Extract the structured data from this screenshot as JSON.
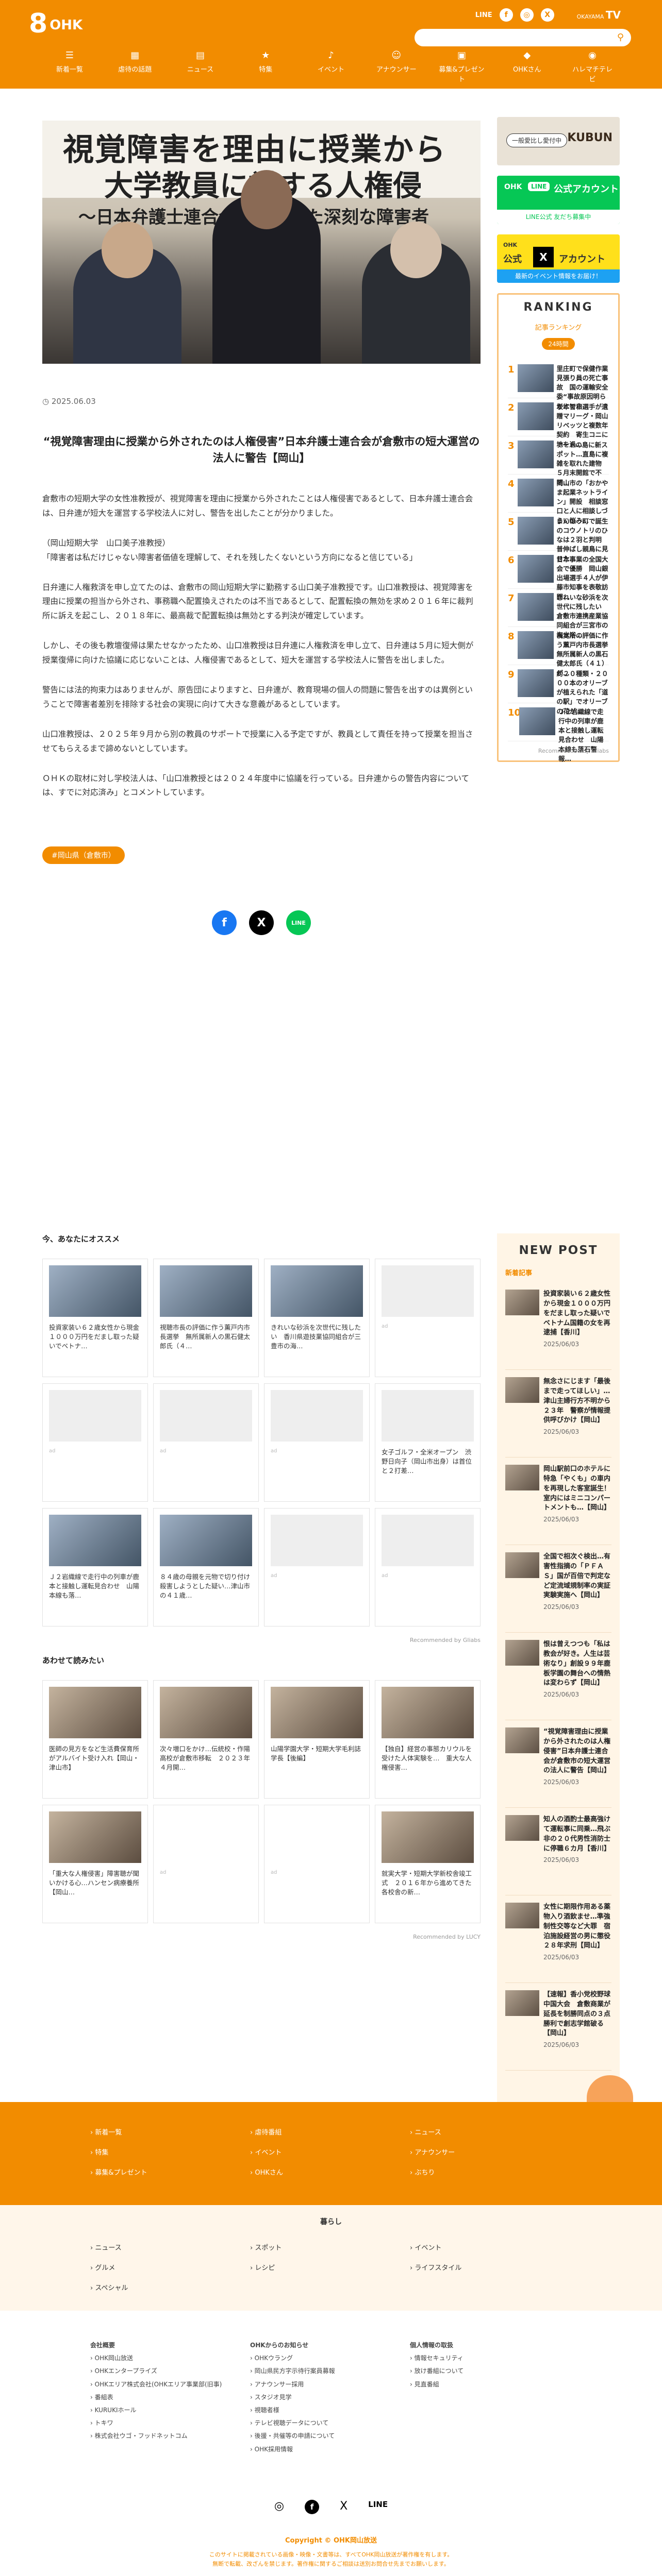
{
  "brand": {
    "logo_num": "8",
    "logo_text": "OHK",
    "tv_mark": "TV",
    "tv_brand": "OKAYAMA"
  },
  "search": {
    "placeholder": ""
  },
  "nav": [
    {
      "icon": "☰",
      "label": "新着一覧"
    },
    {
      "icon": "▦",
      "label": "虐待の話題"
    },
    {
      "icon": "▤",
      "label": "ニュース"
    },
    {
      "icon": "★",
      "label": "特集"
    },
    {
      "icon": "♪",
      "label": "イベント"
    },
    {
      "icon": "☺",
      "label": "アナウンサー"
    },
    {
      "icon": "▣",
      "label": "募集&プレゼント"
    },
    {
      "icon": "◆",
      "label": "OHKさん"
    },
    {
      "icon": "◉",
      "label": "ハレマチテレビ"
    }
  ],
  "article": {
    "hero_text": [
      "視覚障害を理由に授業から",
      "大学教員に対する人権侵",
      "～日本弁護士連合会が認定した深刻な障害者"
    ],
    "date": "2025.06.03",
    "title": "“視覚障害理由に授業から外されたのは人権侵害”日本弁護士連合会が倉敷市の短大運営の法人に警告【岡山】",
    "paragraphs": [
      "倉敷市の短期大学の女性准教授が、視覚障害を理由に授業から外されたことは人権侵害であるとして、日本弁護士連合会は、日弁連が短大を運営する学校法人に対し、警告を出したことが分かりました。",
      "（岡山短期大学　山口美子准教授）\n「障害者は私だけじゃない障害者価値を理解して、それを残したくないという方向になると信じている」",
      "日弁連に人権救済を申し立てたのは、倉敷市の岡山短期大学に勤務する山口美子准教授です。山口准教授は、視覚障害を理由に授業の担当から外され、事務職へ配置換えされたのは不当であるとして、配置転換の無効を求め２０１６年に裁判所に訴えを起こし、２０１８年に、最高裁で配置転換は無効とする判決が確定しています。",
      "しかし、その後も教壇復帰は果たせなかったため、山口准教授は日弁連に人権救済を申し立て、日弁連は５月に短大側が授業復帰に向けた協議に応じないことは、人権侵害であるとして、短大を運営する学校法人に警告を出しました。",
      "警告には法的拘束力はありませんが、原告団によりますと、日弁連が、教育現場の個人の問題に警告を出すのは異例ということで障害者差別を排除する社会の実現に向けて大きな意義があるとしています。",
      "山口准教授は、２０２５年９月から別の教員のサポートで授業に入る予定ですが、教員として責任を持って授業を担当させてもらえるまで諦めないとしています。",
      "ＯＨＫの取材に対し学校法人は、「山口准教授とは２０２４年度中に協議を行っている。日弁連からの警告内容については、すでに対応済み」とコメントしています。"
    ],
    "tag": "#岡山県（倉敷市）"
  },
  "share": {
    "facebook": "f",
    "x": "X",
    "line": "LINE"
  },
  "side": {
    "banner1": {
      "label": "一般愛比し愛付中",
      "brand": "KUBUN"
    },
    "banner2": {
      "brand": "OHK",
      "line": "LINE",
      "title": "公式アカウント",
      "sub": "LINE公式 友だち募集中"
    },
    "banner3": {
      "brand": "OHK",
      "x": "X",
      "title": "公式",
      "title2": "アカウント",
      "sub": "最新のイベント情報をお届け！"
    },
    "ranking_title": "RANKING",
    "ranking_tab": "記事ランキング",
    "ranking_pill": "24時間",
    "ranking": [
      {
        "n": "1",
        "t": "里庄町で保健作業見張り員の死亡事故　国の運輸安全委“事故原因明らかにでき…"
      },
      {
        "n": "2",
        "t": "坂本智和選手が遺贈マリーグ・岡山リベッツと複数年契約　寄生コニに地を過…"
      },
      {
        "n": "3",
        "t": "アートの島に新スポット…直島に複雑を取れた建物　５月末開館で不明…"
      },
      {
        "n": "4",
        "t": "岡山市の「おかやま起業ネットライン」開設　相談窓口と人に相談しづらい悩み…"
      },
      {
        "n": "5",
        "t": "まんのう町で誕生のコウノトリのひなは２羽と判明　普伸ばし親鳥に見せた…"
      },
      {
        "n": "6",
        "t": "日本事業の全国大会で優勝　岡山銀出場選手４人が伊藤市知事を表敬訪問…"
      },
      {
        "n": "7",
        "t": "きれいな砂浜を次世代に残したい　倉敷市連携産業協同組合が三宮市の海水浴…"
      },
      {
        "n": "8",
        "t": "視覚所の評価に作う薫戸内市長選挙　無所属新人の黒石健太郎氏（４１）が…"
      },
      {
        "n": "9",
        "t": "約２０種類・２０００本のオリーブが植えられた「道の駅」でオリーブの花が…"
      },
      {
        "n": "10",
        "t": "Ｊ２岩織線で走行中の列車が鹿本と接触し運転見合わせ　山陽本線も落石警報…"
      }
    ],
    "powered": "Recommended by Gliabs"
  },
  "recommend": {
    "title": "今、あなたにオススメ",
    "cards": [
      {
        "t": "投資家装い６２歳女性から現金１０００万円をだまし取った疑いでベトナ…",
        "img": true
      },
      {
        "t": "視聴市長の評価に作う薫戸内市長選挙　無所属新人の黒石健太郎氏（４…",
        "img": true
      },
      {
        "t": "きれいな砂浜を次世代に残したい　香川県遊技業協同組合が三豊市の海…",
        "img": true
      },
      {
        "t": "ad",
        "img": false
      },
      {
        "t": "ad",
        "img": false
      },
      {
        "t": "ad",
        "img": false
      },
      {
        "t": "ad",
        "img": false
      },
      {
        "t": "女子ゴルフ・全米オープン　渋野日向子（岡山市出身）は首位と２打差…",
        "img": false
      },
      {
        "t": "Ｊ２岩織線で走行中の列車が鹿本と接触し運転見合わせ　山陽本線も落…",
        "img": true
      },
      {
        "t": "８４歳の母親を元物で切り付け殺害しようとした疑い…津山市の４１歳…",
        "img": true
      },
      {
        "t": "ad",
        "img": false
      },
      {
        "t": "ad",
        "img": false
      }
    ],
    "powered": "Recommended by Gliabs"
  },
  "also": {
    "title": "あわせて読みたい",
    "cards": [
      {
        "t": "医師の見方をなど生活費保育所がアルバイト受け入れ【岡山・津山市】"
      },
      {
        "t": "次々増口をかけ…伝統校・作陽高校が倉敷市移転　２０２３年４月開…"
      },
      {
        "t": "山陽学園大学・短期大学毛利誌学長【後編】"
      },
      {
        "t": "【独自】経営の事態カリウルを受けた人体実験を…　重大な人権侵害…"
      },
      {
        "t": "「重大な人権侵害」障害聴が聞いかける心…ハンセン病療養所【岡山…"
      },
      {
        "t": "ad"
      },
      {
        "t": "ad"
      },
      {
        "t": "就実大学・短期大学新校舎竣工式　２０１６年から進めてきた各校舎の新…"
      }
    ],
    "powered": "Recommended by LUCY"
  },
  "newpost": {
    "title": "NEW POST",
    "tab": "新着記事",
    "items": [
      {
        "t": "投資家装い６２歳女性から現金１０００万円をだまし取った疑いでベトナム国籍の女を再逮捕【香川】",
        "d": "2025/06/03"
      },
      {
        "t": "無念さにじます「最後まで走ってほしい」…津山主婦行方不明から２３年　警察が情報提供呼びかけ【岡山】",
        "d": "2025/06/03"
      },
      {
        "t": "岡山駅前口のホテルに特急「やくも」の車内を再現した客室誕生！室内にはミニコンパートメントも…【岡山】",
        "d": "2025/06/03"
      },
      {
        "t": "全国で相次ぐ検出…有害性指摘の「ＰＦＡＳ」国が百倍で判定など定流域規制率の実証実験実施へ【岡山】",
        "d": "2025/06/03"
      },
      {
        "t": "恨は曾えつつも「私は教会が好き。人生は芸術なり」創設９９年鹿板学園の舞台への情熱は変わらず【岡山】",
        "d": "2025/06/03"
      },
      {
        "t": "“視覚障害理由に授業から外されたのは人権侵害”日本弁護士連合会が倉敷市の短大運営の法人に警告【岡山】",
        "d": "2025/06/03"
      },
      {
        "t": "知人の酒酌士最高強けて運転事に同乗…飛ぶ非の２０代男性消防士に停職６カ月【香川】",
        "d": "2025/06/03"
      },
      {
        "t": "女性に期限作用ある薬物入り酒飲ませ…準強制性交等など大罪　宿泊施設経営の男に懲役２８年求刑【岡山】",
        "d": "2025/06/03"
      },
      {
        "t": "【速報】香小党校野球中国大会　倉敷商業が延長を制勝同点の３点勝利で創志学館破る【岡山】",
        "d": "2025/06/03"
      }
    ]
  },
  "footer": {
    "cols": [
      "新着一覧",
      "虐待番組",
      "ニュース",
      "特集",
      "イベント",
      "アナウンサー",
      "募集&プレゼント",
      "OHKさん",
      "ぶちり"
    ],
    "kurashi_title": "暮らし",
    "kurashi": [
      "ニュース",
      "スポット",
      "イベント",
      "グルメ",
      "レシピ",
      "ライフスタイル",
      "スペシャル"
    ],
    "col1_title": "会社概要",
    "col1": [
      "OHK岡山放送",
      "OHKエンタープライズ",
      "OHKエリア株式会社(OHKエリア事業部(旧事)",
      "番組表",
      "KURUKIホール",
      "トキワ",
      "株式会社ウゴ・フッドネットコム"
    ],
    "col2_title": "OHKからのお知らせ",
    "col2": [
      "OHKウラング",
      "岡山県民方字示待行案員募報",
      "アナウンサー採用",
      "スタジオ見学",
      "視聴者様",
      "テレビ視聴データについて",
      "後援・共催等の申請について",
      "OHK採用情報"
    ],
    "col3_title": "個人情報の取扱",
    "col3": [
      "情報セキュリティ",
      "放け番組について",
      "見直番組"
    ],
    "copyright": "Copyright © OHK岡山放送",
    "note1": "このサイトに掲載されている画像・映像・文書等は、すべてOHK岡山放送が著作権を有します。",
    "note2": "無断で転載、改ざんを禁じます。著作権に関するご相談は送別お問合せ先までお願いします。"
  },
  "colors": {
    "accent": "#f28c00",
    "line": "#06c755",
    "x": "#000000",
    "facebook": "#1877f2"
  }
}
